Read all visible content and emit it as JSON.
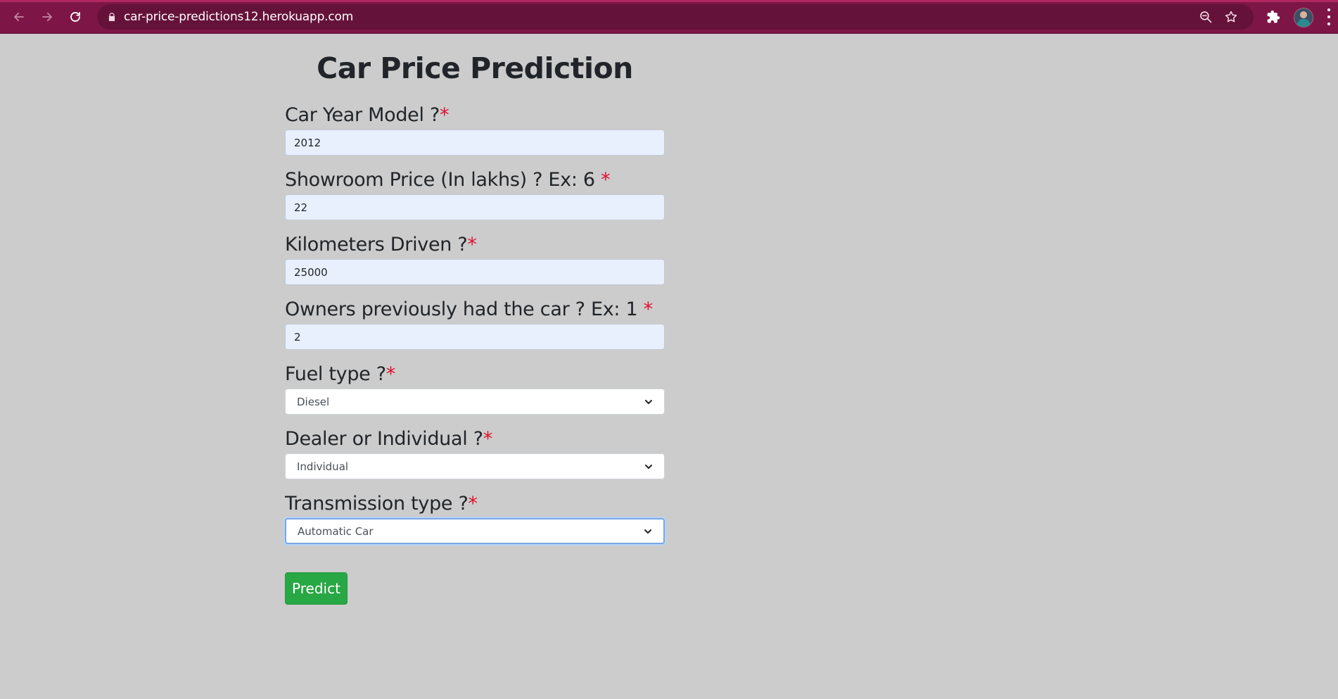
{
  "browser": {
    "url": "car-price-predictions12.herokuapp.com",
    "theme_color": "#7d1646"
  },
  "page": {
    "title": "Car Price Prediction",
    "required_marker": "*",
    "required_color": "#e0102c"
  },
  "form": {
    "year": {
      "label": "Car Year Model ?",
      "value": "2012"
    },
    "price": {
      "label": "Showroom Price (In lakhs) ? Ex: 6 ",
      "value": "22"
    },
    "kms": {
      "label": "Kilometers Driven ?",
      "value": "25000"
    },
    "owners": {
      "label": "Owners previously had the car ? Ex: 1 ",
      "value": "2"
    },
    "fuel": {
      "label": "Fuel type ?",
      "selected": "Diesel"
    },
    "seller": {
      "label": "Dealer or Individual ?",
      "selected": "Individual"
    },
    "transmission": {
      "label": "Transmission type ?",
      "selected": "Automatic Car"
    },
    "submit_label": "Predict",
    "submit_color": "#28a745"
  }
}
